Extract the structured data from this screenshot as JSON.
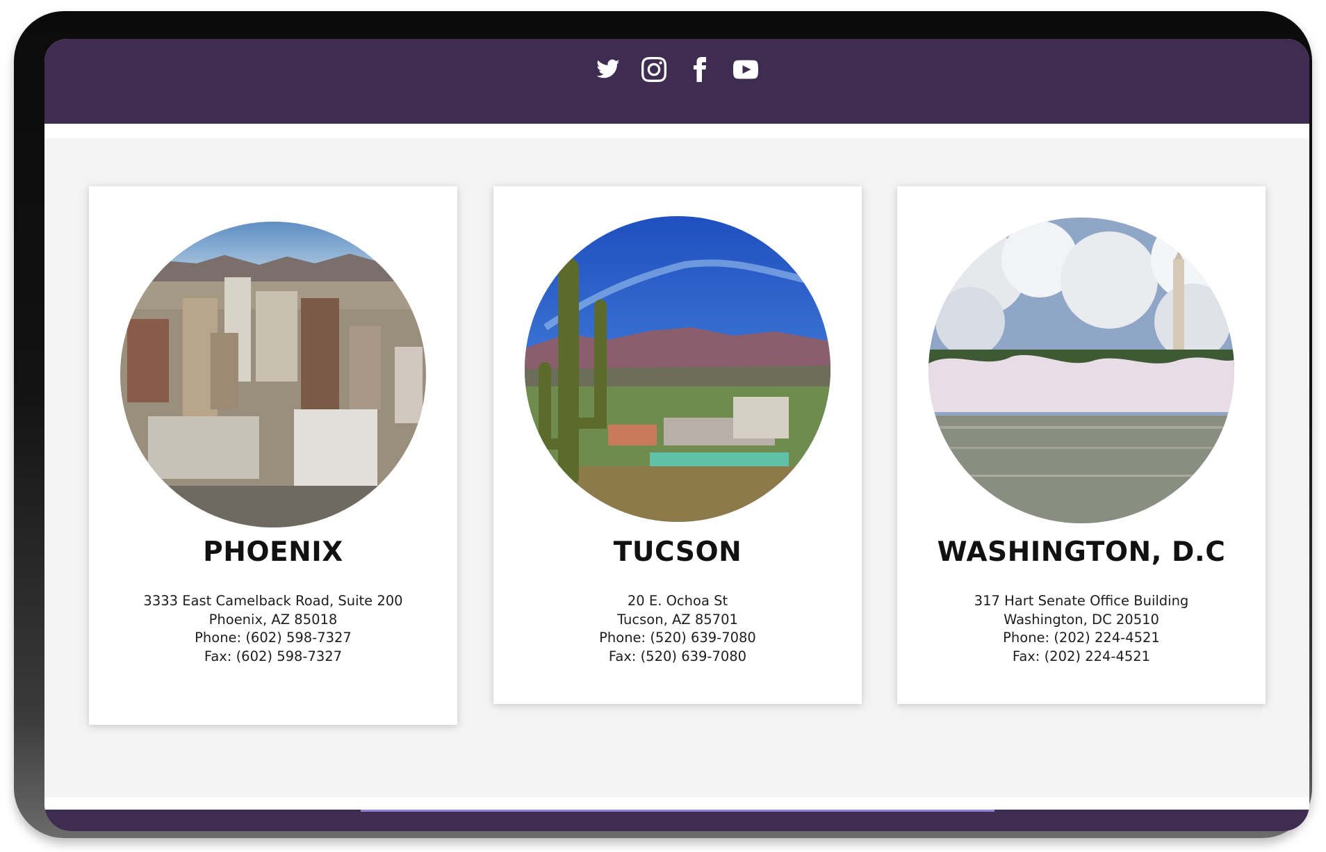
{
  "social": {
    "icons": [
      "twitter-icon",
      "instagram-icon",
      "facebook-icon",
      "youtube-icon"
    ]
  },
  "colors": {
    "header": "#3f2d51",
    "content_bg": "#f3f3f3",
    "card_bg": "#ffffff",
    "footer_accent": "#8f84d8"
  },
  "offices": [
    {
      "city": "PHOENIX",
      "address1": "3333 East Camelback Road, Suite 200",
      "address2": "Phoenix, AZ 85018",
      "phone": "Phone: (602) 598-7327",
      "fax": "Fax: (602) 598-7327",
      "photo": "phoenix-skyline-photo"
    },
    {
      "city": "TUCSON",
      "address1": "20 E. Ochoa St",
      "address2": "Tucson, AZ 85701",
      "phone": "Phone: (520) 639-7080",
      "fax": "Fax: (520) 639-7080",
      "photo": "tucson-saguaro-photo"
    },
    {
      "city": "WASHINGTON, D.C",
      "address1": "317 Hart Senate Office Building",
      "address2": "Washington, DC 20510",
      "phone": "Phone: (202) 224-4521",
      "fax": "Fax: (202) 224-4521",
      "photo": "washington-monument-photo"
    }
  ]
}
